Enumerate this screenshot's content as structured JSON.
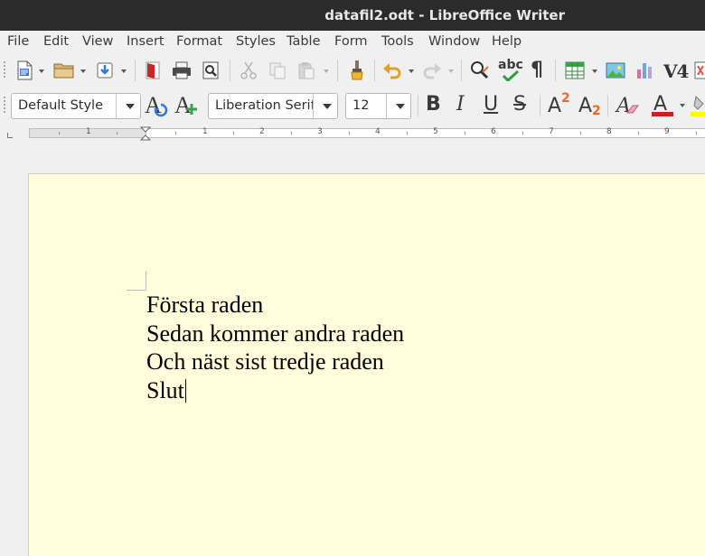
{
  "window": {
    "title": "datafil2.odt - LibreOffice Writer"
  },
  "menu": [
    "File",
    "Edit",
    "View",
    "Insert",
    "Format",
    "Styles",
    "Table",
    "Form",
    "Tools",
    "Window",
    "Help"
  ],
  "toolbar_standard": {
    "icons": [
      "new-document-icon",
      "open-folder-icon",
      "save-icon",
      "export-pdf-icon",
      "print-icon",
      "print-preview-icon",
      "cut-icon",
      "copy-icon",
      "paste-icon",
      "clone-formatting-icon",
      "undo-icon",
      "redo-icon",
      "find-replace-icon",
      "spelling-icon",
      "formatting-marks-icon",
      "insert-table-icon",
      "insert-image-icon",
      "insert-chart-icon",
      "insert-field-icon",
      "insert-special-icon"
    ],
    "spelling_label": "abc",
    "formatting_marks_glyph": "¶",
    "field_label": "V4"
  },
  "toolbar_formatting": {
    "paragraph_style": "Default Style",
    "font_name": "Liberation Serif",
    "font_size": "12",
    "bold": "B",
    "italic": "I",
    "underline": "U",
    "strikethrough": "S",
    "superscript_base": "A",
    "superscript_exp": "2",
    "subscript_base": "A",
    "subscript_exp": "2",
    "font_color_label": "A"
  },
  "ruler": {
    "numbers": [
      "1",
      "1",
      "2",
      "3",
      "4",
      "5",
      "6",
      "7",
      "8",
      "9"
    ]
  },
  "document": {
    "lines": [
      "Första raden",
      "Sedan kommer andra raden",
      "Och näst sist tredje raden",
      "Slut"
    ]
  },
  "colors": {
    "page_background": "#ffffdb",
    "titlebar": "#2b2b2b",
    "font_color_bar": "#c9211e",
    "highlight_bar": "#ffff00"
  }
}
